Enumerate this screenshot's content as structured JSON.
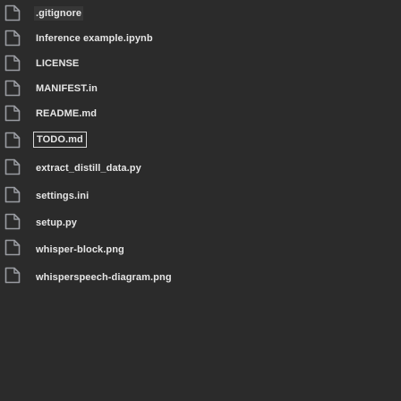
{
  "files": [
    {
      "name": ".gitignore",
      "icon": "file-icon"
    },
    {
      "name": "Inference example.ipynb",
      "icon": "file-icon"
    },
    {
      "name": "LICENSE",
      "icon": "file-icon"
    },
    {
      "name": "MANIFEST.in",
      "icon": "file-icon"
    },
    {
      "name": "README.md",
      "icon": "file-icon"
    },
    {
      "name": "TODO.md",
      "icon": "file-icon",
      "selected": true
    },
    {
      "name": "extract_distill_data.py",
      "icon": "file-icon"
    },
    {
      "name": "settings.ini",
      "icon": "file-icon"
    },
    {
      "name": "setup.py",
      "icon": "file-icon"
    },
    {
      "name": "whisper-block.png",
      "icon": "file-icon"
    },
    {
      "name": "whisperspeech-diagram.png",
      "icon": "file-icon"
    }
  ],
  "colors": {
    "background": "#2b2b2b",
    "text": "#e6e6e6",
    "icon_stroke": "#9a9ca2",
    "selection_outline": "#d8d8d8"
  }
}
